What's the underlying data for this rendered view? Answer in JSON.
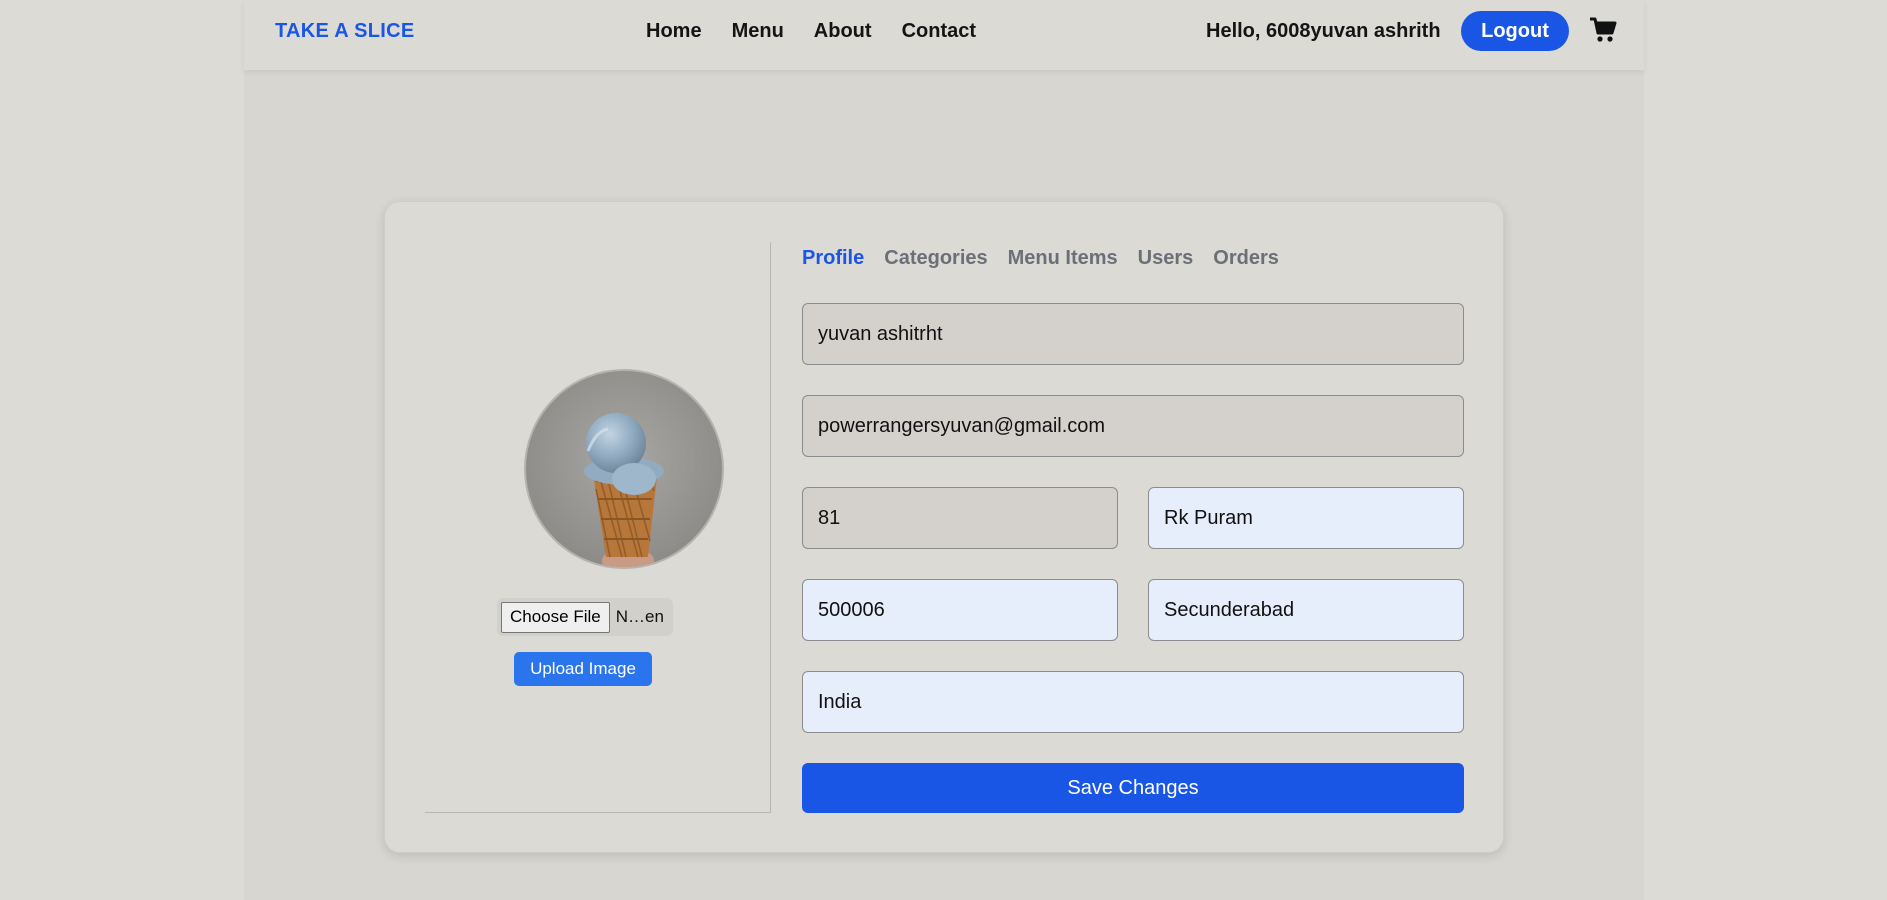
{
  "header": {
    "brand": "TAKE A SLICE",
    "nav": [
      "Home",
      "Menu",
      "About",
      "Contact"
    ],
    "greeting": "Hello, 6008yuvan ashrith",
    "logout_label": "Logout",
    "cart_icon": "cart-icon"
  },
  "profile": {
    "file_button": "Choose File",
    "file_name": "N…en",
    "upload_label": "Upload Image",
    "avatar_icon": "ice-cream-cone-photo"
  },
  "tabs": [
    "Profile",
    "Categories",
    "Menu Items",
    "Users",
    "Orders"
  ],
  "active_tab": "Profile",
  "form": {
    "name": "yuvan ashitrht",
    "email": "powerrangersyuvan@gmail.com",
    "house_no": "81",
    "street": "Rk Puram",
    "postal_code": "500006",
    "city": "Secunderabad",
    "country": "India",
    "save_label": "Save Changes"
  },
  "colors": {
    "accent": "#1a56e6",
    "upload": "#2a75ee",
    "tab_inactive": "#6b7078",
    "readonly_field": "#d4d1cd",
    "editable_field": "#e7eefb"
  }
}
